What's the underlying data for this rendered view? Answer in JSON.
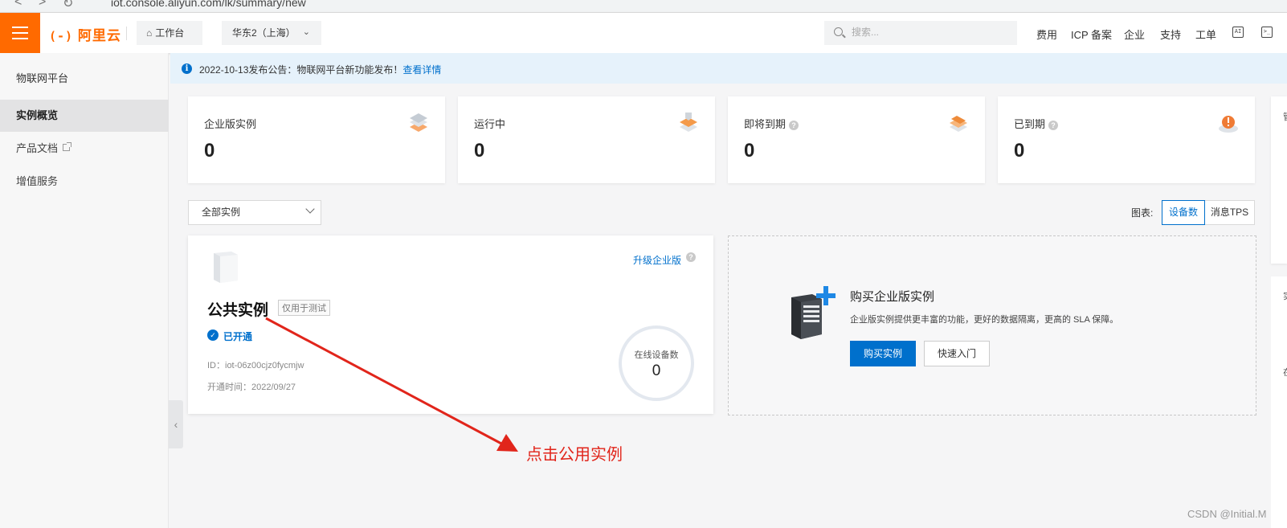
{
  "browser": {
    "url": "iot.console.aliyun.com/lk/summary/new"
  },
  "topbar": {
    "logo_bracket": "(-)",
    "logo_text": "阿里云",
    "workbench": "工作台",
    "region": "华东2（上海）",
    "search_placeholder": "搜索...",
    "nav": [
      "费用",
      "ICP 备案",
      "企业",
      "支持",
      "工单"
    ]
  },
  "sidebar": {
    "title": "物联网平台",
    "items": [
      {
        "label": "实例概览",
        "active": true
      },
      {
        "label": "产品文档",
        "external": true
      },
      {
        "label": "增值服务"
      }
    ]
  },
  "notice": {
    "text": "2022-10-13发布公告：物联网平台新功能发布！",
    "link": "查看详情"
  },
  "stats": [
    {
      "label": "企业版实例",
      "value": "0",
      "help": false
    },
    {
      "label": "运行中",
      "value": "0",
      "help": false
    },
    {
      "label": "即将到期",
      "value": "0",
      "help": true
    },
    {
      "label": "已到期",
      "value": "0",
      "help": true
    }
  ],
  "filter": {
    "selected": "全部实例"
  },
  "chart_toggle": {
    "label": "图表:",
    "options": [
      "设备数",
      "消息TPS"
    ],
    "selected": "设备数"
  },
  "public_instance": {
    "name": "公共实例",
    "tag": "仅用于测试",
    "status": "已开通",
    "id_line": "ID：iot-06z00cjz0fycmjw",
    "opened_line": "开通时间：2022/09/27",
    "upgrade": "升级企业版",
    "online_label": "在线设备数",
    "online_value": "0"
  },
  "buy_card": {
    "title": "购买企业版实例",
    "desc": "企业版实例提供更丰富的功能，更好的数据隔离，更高的 SLA 保障。",
    "buy_btn": "购买实例",
    "guide_btn": "快速入门"
  },
  "annotation": {
    "text": "点击公用实例",
    "color": "#e1251b"
  },
  "watermark": "CSDN @Initial.M",
  "colors": {
    "brand": "#ff6a00",
    "primary": "#0070cc",
    "notice_bg": "#e6f2fb"
  }
}
